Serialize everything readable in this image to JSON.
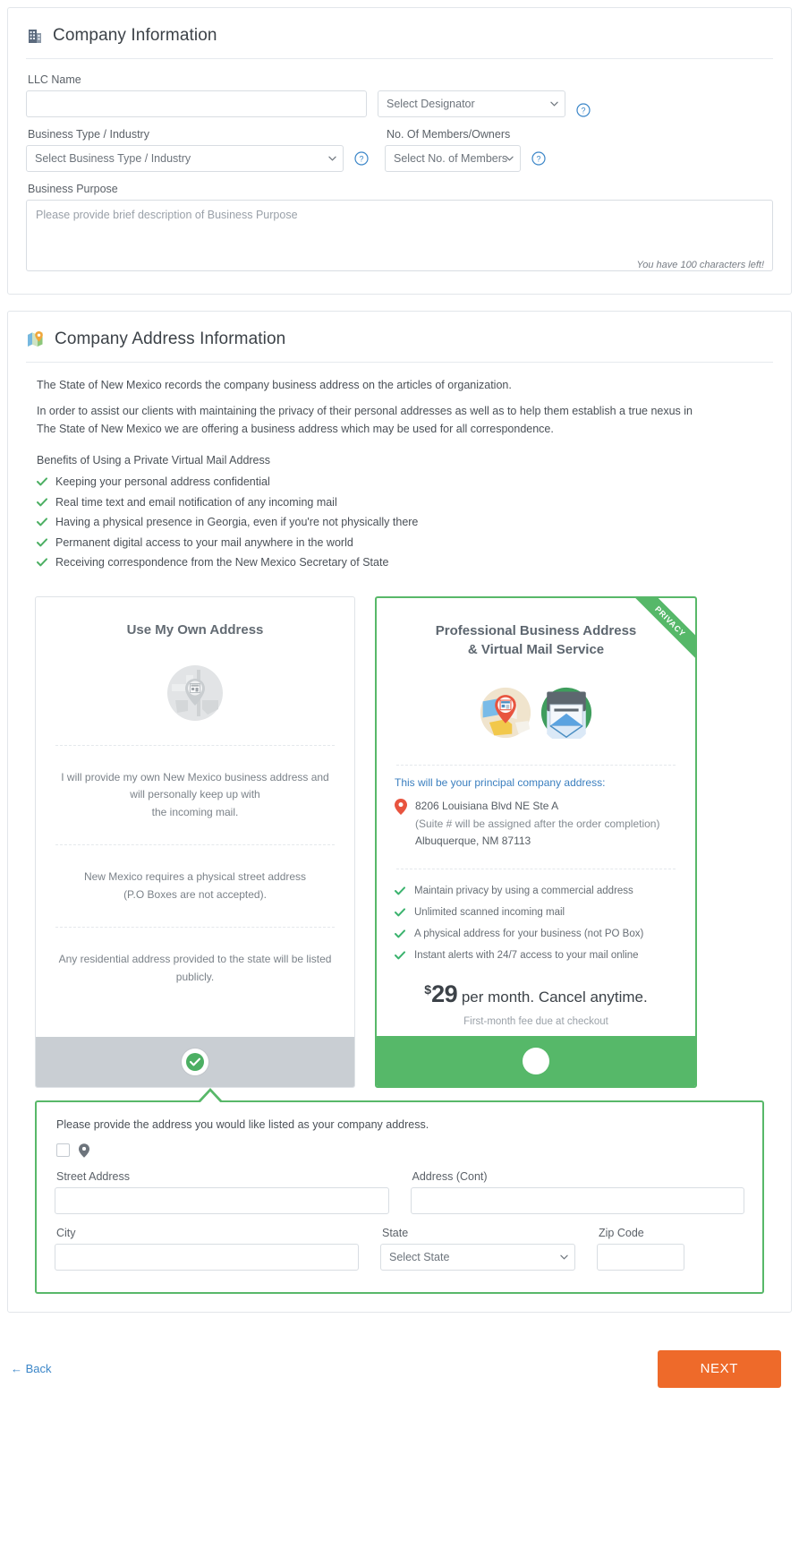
{
  "company_info": {
    "title": "Company Information",
    "icon": "office-building-icon",
    "llc_name": {
      "label": "LLC Name",
      "value": "",
      "placeholder": ""
    },
    "designator": {
      "selected": "Select Designator",
      "help_icon": "question-mark-icon"
    },
    "business_type": {
      "label": "Business Type / Industry",
      "selected": "Select Business Type / Industry",
      "help_icon": "question-mark-icon"
    },
    "members": {
      "label": "No. Of Members/Owners",
      "selected": "Select No. of Members",
      "help_icon": "question-mark-icon"
    },
    "business_purpose": {
      "label": "Business Purpose",
      "value": "",
      "placeholder": "Please provide brief description of Business Purpose",
      "counter": "You have 100 characters left!"
    }
  },
  "address_info": {
    "title": "Company Address Information",
    "icon": "map-pin-icon",
    "paragraphs": [
      "The State of New Mexico records the company business address on the articles of organization.",
      "In order to assist our clients with maintaining the privacy of their personal addresses as well as to help them establish a true nexus in The State of New Mexico we are offering a business address which may be used for all correspondence."
    ],
    "benefits_heading": "Benefits of Using a Private Virtual Mail Address",
    "benefits": [
      "Keeping your personal address confidential",
      "Real time text and email notification of any incoming mail",
      "Having a physical presence in Georgia, even if you're not physically there",
      "Permanent digital access to your mail anywhere in the world",
      "Receiving correspondence from the New Mexico Secretary of State"
    ]
  },
  "options": {
    "own_address": {
      "title": "Use My Own Address",
      "art_icon": "map-location-grayscale-icon",
      "blocks": [
        "I will provide my own New Mexico business address and will personally keep up with\nthe incoming mail.",
        "New Mexico requires a physical street address\n(P.O Boxes are not accepted).",
        "Any residential address provided to the state will be listed publicly."
      ],
      "selected": true,
      "selector_icon": "check-circle-icon"
    },
    "virtual_mail": {
      "ribbon": "PRIVACY",
      "title_line1": "Professional Business Address",
      "title_line2": "& Virtual Mail Service",
      "art_icons": [
        "map-pin-storefront-icon",
        "open-envelope-icon"
      ],
      "address_heading": "This will be your principal company address:",
      "address_pin_icon": "location-marker-icon",
      "address_line1": "8206 Louisiana Blvd NE Ste A",
      "address_line2": "(Suite # will be assigned after the order completion)",
      "address_line3": "Albuquerque, NM 87113",
      "features": [
        "Maintain privacy by using a commercial address",
        "Unlimited scanned incoming mail",
        "A physical address for your business (not PO Box)",
        "Instant alerts with 24/7 access to your mail online"
      ],
      "price_currency": "$",
      "price_amount": "29",
      "price_suffix": " per month. Cancel anytime.",
      "price_note": "First-month fee due at checkout",
      "selected": false
    }
  },
  "address_form": {
    "lead": "Please provide the address you would like listed as your company address.",
    "checkbox_checked": false,
    "checkbox_icon": "location-marker-icon",
    "street": {
      "label": "Street Address",
      "value": "",
      "placeholder": ""
    },
    "address_cont": {
      "label": "Address (Cont)",
      "value": "",
      "placeholder": ""
    },
    "city": {
      "label": "City",
      "value": "",
      "placeholder": ""
    },
    "state": {
      "label": "State",
      "selected": "Select State"
    },
    "zip": {
      "label": "Zip Code",
      "value": "",
      "placeholder": ""
    }
  },
  "footer": {
    "back_label": "← Back",
    "next_label": "NEXT"
  },
  "colors": {
    "green": "#58b869",
    "orange": "#ee6a2a",
    "blue_link": "#3b7fbf",
    "gray_footer": "#c9ced3"
  }
}
